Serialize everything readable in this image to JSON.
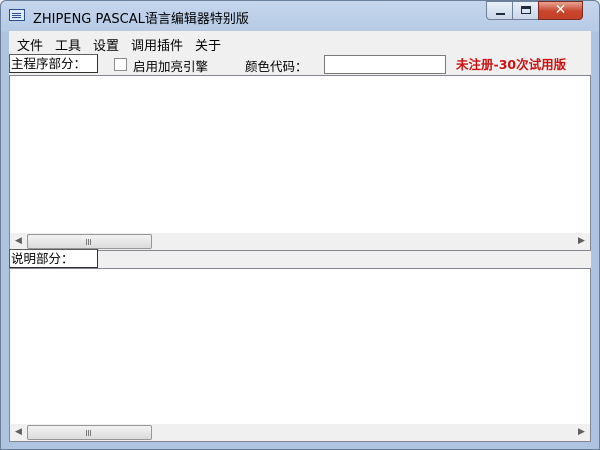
{
  "window": {
    "title": "ZHIPENG PASCAL语言编辑器特别版",
    "icon": "app-icon",
    "controls": {
      "minimize": "minimize-icon",
      "maximize": "maximize-icon",
      "close": "✕"
    }
  },
  "menu": {
    "items": [
      {
        "label": "文件"
      },
      {
        "label": "工具"
      },
      {
        "label": "设置"
      },
      {
        "label": "调用插件"
      },
      {
        "label": "关于"
      }
    ]
  },
  "toolbar": {
    "main_section_label": "主程序部分：",
    "highlight_checkbox_label": "启用加亮引擎",
    "highlight_checked": false,
    "color_code_label": "颜色代码：",
    "color_code_value": "",
    "registration_notice": "未注册-30次试用版",
    "registration_color": "#d01010"
  },
  "description": {
    "section_label": "说明部分："
  }
}
